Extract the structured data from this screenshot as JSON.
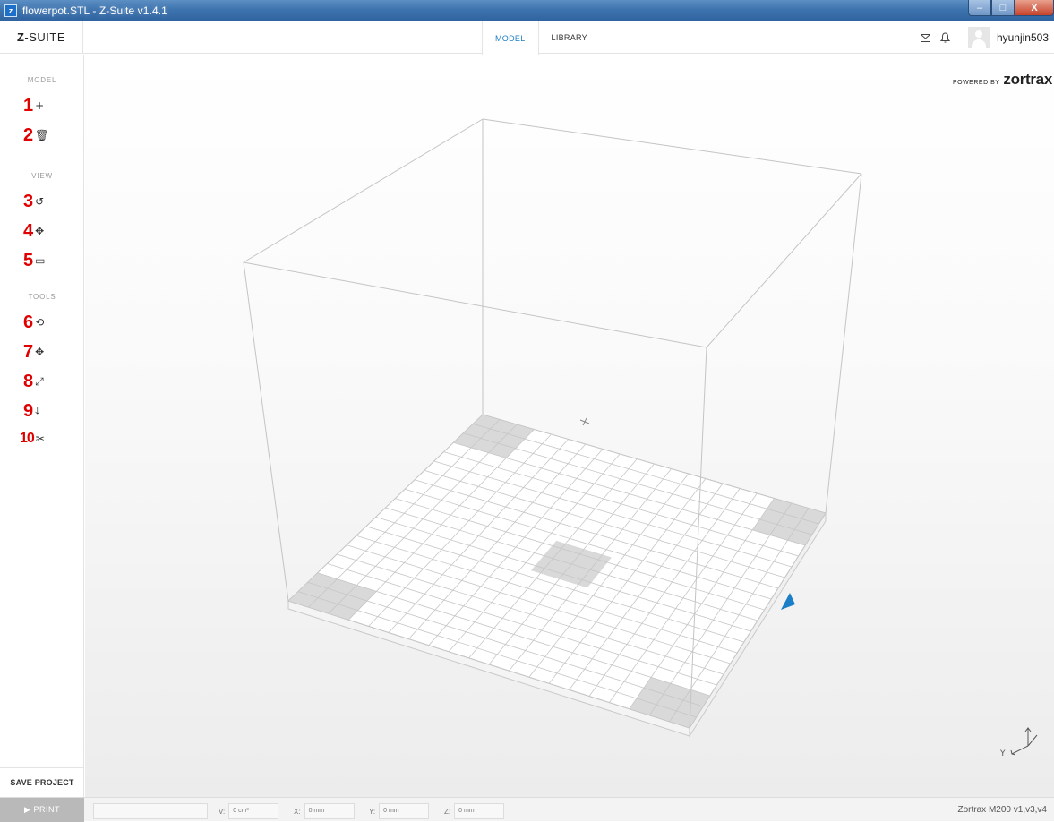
{
  "window": {
    "title": "flowerpot.STL - Z-Suite v1.4.1",
    "app_icon": "z",
    "minimize": "–",
    "maximize": "□",
    "close": "X"
  },
  "header": {
    "logo_bold": "Z",
    "logo_rest": "-SUITE",
    "tabs": [
      {
        "label": "MODEL",
        "active": true
      },
      {
        "label": "LIBRARY",
        "active": false
      }
    ],
    "mail_icon": "✉",
    "bell_icon": "🔔",
    "username": "hyunjin503"
  },
  "sidebar": {
    "sections": {
      "model": "MODEL",
      "view": "VIEW",
      "tools": "TOOLS"
    },
    "tools": [
      {
        "num": "1",
        "icon": "+",
        "name": "add-model"
      },
      {
        "num": "2",
        "icon": "🗑",
        "name": "delete-model"
      },
      {
        "num": "3",
        "icon": "↺",
        "name": "rotate-view"
      },
      {
        "num": "4",
        "icon": "✥",
        "name": "pan-view"
      },
      {
        "num": "5",
        "icon": "▭",
        "name": "camera-view"
      },
      {
        "num": "6",
        "icon": "⟲",
        "name": "rotate-tool"
      },
      {
        "num": "7",
        "icon": "✥",
        "name": "move-tool"
      },
      {
        "num": "8",
        "icon": "⤢",
        "name": "scale-tool"
      },
      {
        "num": "9",
        "icon": "⤓",
        "name": "place-on-bed-tool"
      },
      {
        "num": "10",
        "icon": "✂",
        "name": "cut-tool"
      }
    ],
    "save_project": "SAVE PROJECT"
  },
  "viewport": {
    "powered_by": "POWERED BY",
    "brand": "zortrax",
    "axis_y": "Y"
  },
  "bottom": {
    "print": "▶  PRINT",
    "volume_label": "V:",
    "volume_value": "0 cm³",
    "x_label": "X:",
    "x_value": "0 mm",
    "y_label": "Y:",
    "y_value": "0 mm",
    "z_label": "Z:",
    "z_value": "0 mm",
    "printer": "Zortrax M200 v1,v3,v4"
  },
  "colors": {
    "accent": "#1a7fc6",
    "annotation_red": "#e00000",
    "print_button": "#b9b9b9"
  }
}
